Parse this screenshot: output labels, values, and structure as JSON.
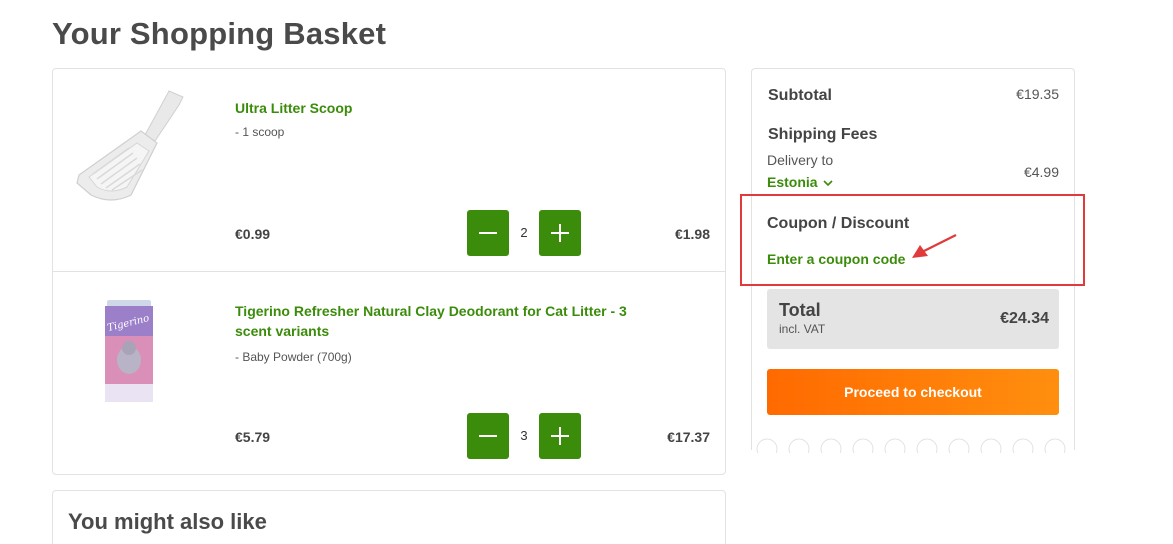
{
  "page": {
    "title": "Your Shopping Basket"
  },
  "basket": {
    "items": [
      {
        "name": "Ultra Litter Scoop",
        "variant": "- 1 scoop",
        "unit_price": "€0.99",
        "quantity": "2",
        "line_total": "€1.98",
        "image_icon": "litter-scoop-image"
      },
      {
        "name": "Tigerino Refresher Natural Clay Deodorant for Cat Litter - 3 scent variants",
        "variant": "- Baby Powder (700g)",
        "unit_price": "€5.79",
        "quantity": "3",
        "line_total": "€17.37",
        "image_icon": "deodorant-can-image",
        "image_brand_text": "Tigerino"
      }
    ]
  },
  "recommendations": {
    "title": "You might also like"
  },
  "summary": {
    "subtotal_label": "Subtotal",
    "subtotal_value": "€19.35",
    "shipping_label": "Shipping Fees",
    "delivery_label": "Delivery to",
    "country": "Estonia",
    "shipping_value": "€4.99",
    "coupon_label": "Coupon / Discount",
    "coupon_link": "Enter a coupon code",
    "total_label": "Total",
    "total_vat": "incl. VAT",
    "total_value": "€24.34",
    "checkout_label": "Proceed to checkout"
  },
  "colors": {
    "accent_green": "#3b8c0a",
    "checkout_orange": "#ff7a00",
    "annotation_red": "#e03a3a"
  }
}
